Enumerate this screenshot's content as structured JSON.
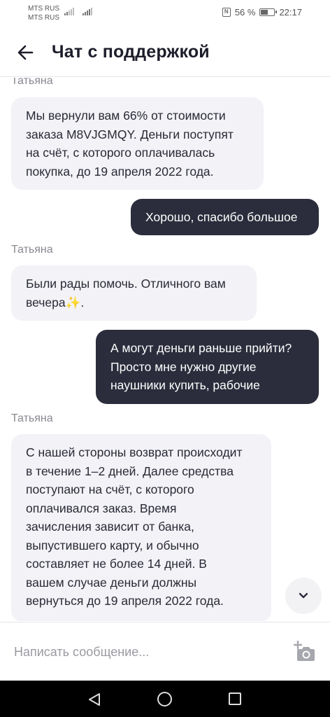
{
  "status_bar": {
    "carrier_1": "MTS RUS",
    "carrier_2": "MTS RUS",
    "battery": "56 %",
    "time": "22:17",
    "battery_level": 0.56
  },
  "header": {
    "title": "Чат с поддержкой"
  },
  "messages": [
    {
      "type": "sender",
      "text": "Татьяна"
    },
    {
      "type": "incoming",
      "lines": [
        "Мы вернули вам 66% от стоимости",
        "заказа M8VJGMQY. Деньги поступят",
        "на счёт, с которого оплачивалась",
        "покупка, до 19 апреля 2022 года."
      ]
    },
    {
      "type": "outgoing",
      "lines": [
        "Хорошо, спасибо большое"
      ]
    },
    {
      "type": "sender",
      "text": "Татьяна"
    },
    {
      "type": "incoming",
      "lines": [
        "Были рады помочь. Отличного вам",
        "вечера✨."
      ]
    },
    {
      "type": "outgoing",
      "lines": [
        "А могут деньги раньше прийти?",
        "Просто мне нужно другие",
        "наушники купить, рабочие"
      ]
    },
    {
      "type": "sender",
      "text": "Татьяна"
    },
    {
      "type": "incoming",
      "lines": [
        "С нашей стороны возврат происходит",
        "в течение 1–2 дней. Далее средства",
        "поступают на счёт, с которого",
        "оплачивался заказ. Время",
        "зачисления зависит от банка,",
        "выпустившего карту, и обычно",
        "составляет не более 14 дней. В",
        "вашем случае деньги должны",
        "вернуться до 19 апреля 2022 года."
      ]
    }
  ],
  "input": {
    "placeholder": "Написать сообщение..."
  },
  "icons": {
    "back": "arrow-left-icon",
    "scroll_down": "chevron-down-icon",
    "camera": "camera-add-icon",
    "nav_back": "triangle-back-icon",
    "nav_home": "circle-home-icon",
    "nav_recent": "square-recent-icon"
  }
}
